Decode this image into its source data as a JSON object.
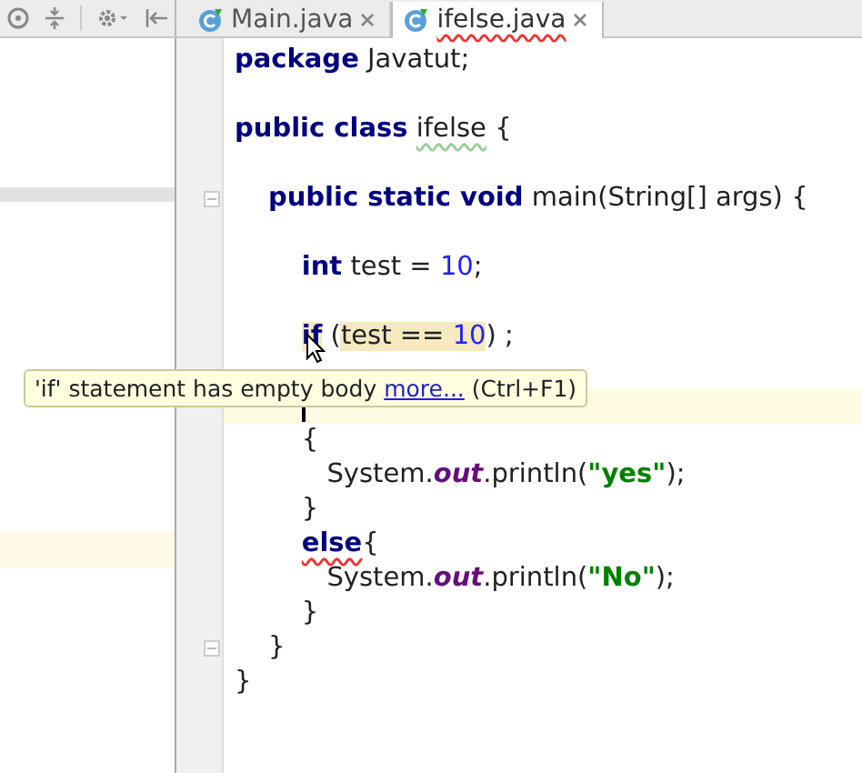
{
  "tabs": [
    {
      "label": "Main.java",
      "selected": false,
      "error_underline": false
    },
    {
      "label": "ifelse.java",
      "selected": true,
      "error_underline": true
    }
  ],
  "code": [
    {
      "current": false,
      "tokens": [
        {
          "t": "package",
          "kind": "kw"
        },
        {
          "t": " Javatut;",
          "kind": "plain"
        }
      ]
    },
    {
      "current": false
    },
    {
      "current": false,
      "tokens": [
        {
          "t": "public class",
          "kind": "kw"
        },
        {
          "t": " ifelse",
          "kind": "plain",
          "weak_underline": true
        },
        {
          "t": " {",
          "kind": "plain"
        }
      ]
    },
    {
      "current": false
    },
    {
      "current": false,
      "fold": true,
      "tokens": [
        {
          "t": "    public static void",
          "kind": "kw"
        },
        {
          "t": " main(String[] args) {",
          "kind": "plain"
        }
      ]
    },
    {
      "current": false
    },
    {
      "current": false,
      "tokens": [
        {
          "t": "        int",
          "kind": "kw"
        },
        {
          "t": " test = ",
          "kind": "plain"
        },
        {
          "t": "10",
          "kind": "num"
        },
        {
          "t": ";",
          "kind": "plain"
        }
      ]
    },
    {
      "current": false
    },
    {
      "current": false,
      "tokens": [
        {
          "t": "        if",
          "kind": "kw",
          "highlight": true
        },
        {
          "t": " (",
          "kind": "plain"
        },
        {
          "t": "test == ",
          "kind": "plain",
          "highlight": true
        },
        {
          "t": "10",
          "kind": "num",
          "highlight": true
        },
        {
          "t": ") ;",
          "kind": "plain"
        }
      ]
    },
    {
      "current": false
    },
    {
      "current": true
    },
    {
      "current": false,
      "tokens": [
        {
          "t": "        {",
          "kind": "plain"
        }
      ]
    },
    {
      "current": false,
      "tokens": [
        {
          "t": "           System.",
          "kind": "plain"
        },
        {
          "t": "out",
          "kind": "static"
        },
        {
          "t": ".println(",
          "kind": "plain"
        },
        {
          "t": "\"yes\"",
          "kind": "str"
        },
        {
          "t": ");",
          "kind": "plain"
        }
      ]
    },
    {
      "current": false,
      "tokens": [
        {
          "t": "        }",
          "kind": "plain"
        }
      ]
    },
    {
      "current": false,
      "tokens": [
        {
          "t": "        else",
          "kind": "kw",
          "error_underline": true
        },
        {
          "t": "{",
          "kind": "plain"
        }
      ]
    },
    {
      "current": false,
      "tokens": [
        {
          "t": "           System.",
          "kind": "plain"
        },
        {
          "t": "out",
          "kind": "static"
        },
        {
          "t": ".println(",
          "kind": "plain"
        },
        {
          "t": "\"No\"",
          "kind": "str"
        },
        {
          "t": ");",
          "kind": "plain"
        }
      ]
    },
    {
      "current": false,
      "tokens": [
        {
          "t": "        }",
          "kind": "plain"
        }
      ]
    },
    {
      "current": false,
      "fold": true,
      "tokens": [
        {
          "t": "    }",
          "kind": "plain"
        }
      ]
    },
    {
      "current": false,
      "tokens": [
        {
          "t": "}",
          "kind": "plain"
        }
      ]
    }
  ],
  "tooltip": {
    "text": "'if' statement has empty body",
    "link": "more...",
    "shortcut": "(Ctrl+F1)"
  }
}
